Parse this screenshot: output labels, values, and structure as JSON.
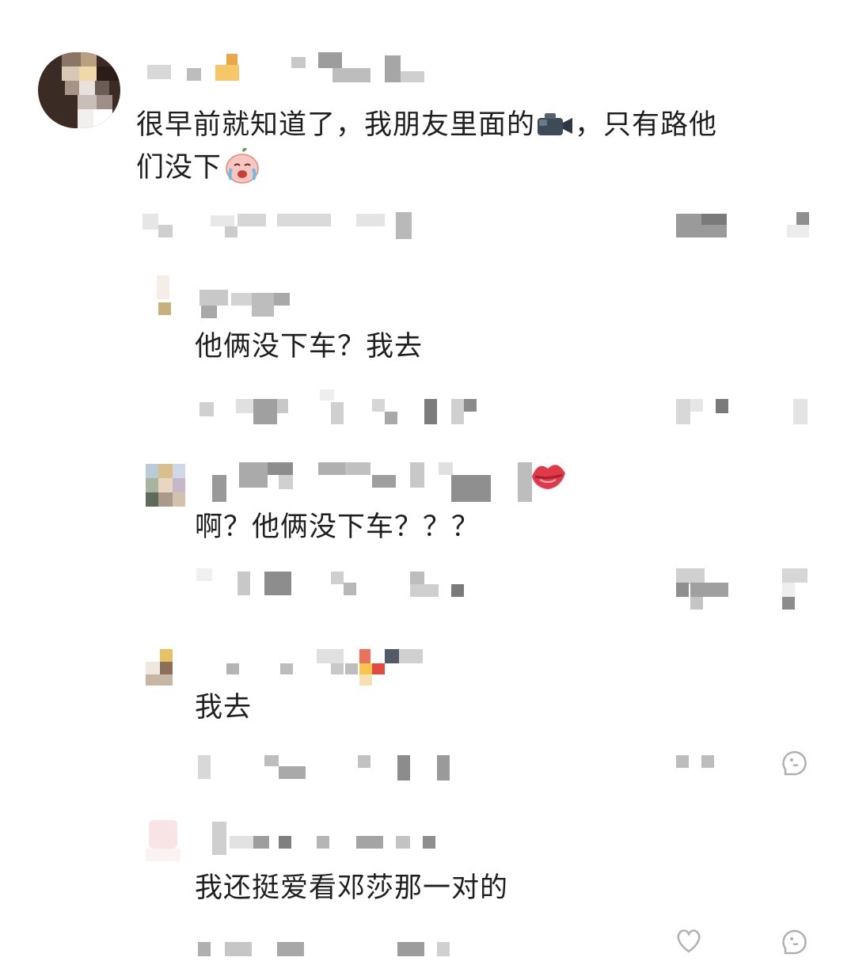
{
  "comments": [
    {
      "text_a": "很早前就知道了，我朋友里面的",
      "text_b": "，只有路他",
      "text_c": "们没下"
    },
    {
      "text": "他俩没下车？我去"
    },
    {
      "text": "啊？他俩没下车？？？"
    },
    {
      "text": "我去"
    },
    {
      "text": "我还挺爱看邓莎那一对的"
    }
  ],
  "icons": {
    "camera": "video-camera-emoji",
    "crying": "crying-peach-emoji",
    "kiss": "kiss-lips-emoji",
    "like": "like-icon",
    "reply": "reply-icon"
  }
}
